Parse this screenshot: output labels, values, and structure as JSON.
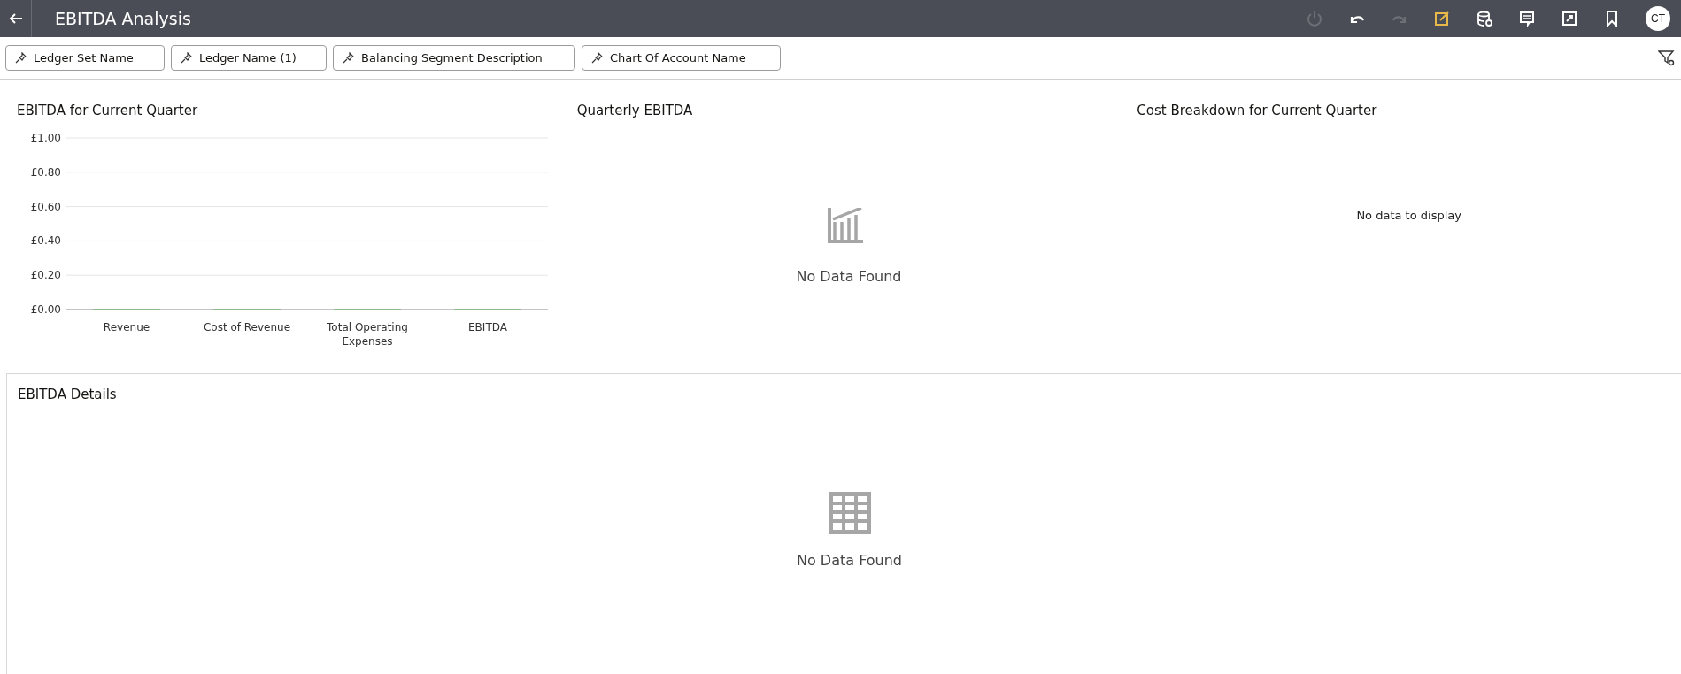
{
  "header": {
    "title": "EBITDA Analysis",
    "toolbar": [
      {
        "kind": "refresh",
        "disabled": true
      },
      {
        "kind": "undo",
        "disabled": false
      },
      {
        "kind": "redo",
        "disabled": true
      },
      {
        "kind": "edit",
        "disabled": false
      },
      {
        "kind": "data",
        "disabled": false
      },
      {
        "kind": "comment",
        "disabled": false
      },
      {
        "kind": "export",
        "disabled": false
      },
      {
        "kind": "bookmark",
        "disabled": false
      }
    ],
    "avatar": "CT"
  },
  "filters": [
    "Ledger Set Name",
    "Ledger Name (1)",
    "Balancing Segment Description",
    "Chart Of Account Name"
  ],
  "panels": [
    {
      "kind": "chart",
      "title": "EBITDA for Current Quarter",
      "chart_data": {
        "type": "bar",
        "categories": [
          "Revenue",
          "Cost of Revenue",
          "Total Operating Expenses",
          "EBITDA"
        ],
        "values": [
          0,
          0,
          0,
          0
        ],
        "grid": true,
        "ylim": [
          0,
          1
        ],
        "yticks": [
          {
            "value": 0,
            "label": "£0.00"
          },
          {
            "value": 0.2,
            "label": "£0.20"
          },
          {
            "value": 0.4,
            "label": "£0.40"
          },
          {
            "value": 0.6,
            "label": "£0.60"
          },
          {
            "value": 0.8,
            "label": "£0.80"
          },
          {
            "value": 1,
            "label": "£1.00"
          }
        ]
      }
    },
    {
      "kind": "empty-chart",
      "title": "Quarterly EBITDA",
      "message": "No Data Found"
    },
    {
      "kind": "plain",
      "title": "Cost Breakdown for Current Quarter",
      "message": "No data to display"
    }
  ],
  "details": {
    "title": "EBITDA Details",
    "message": "No Data Found"
  }
}
